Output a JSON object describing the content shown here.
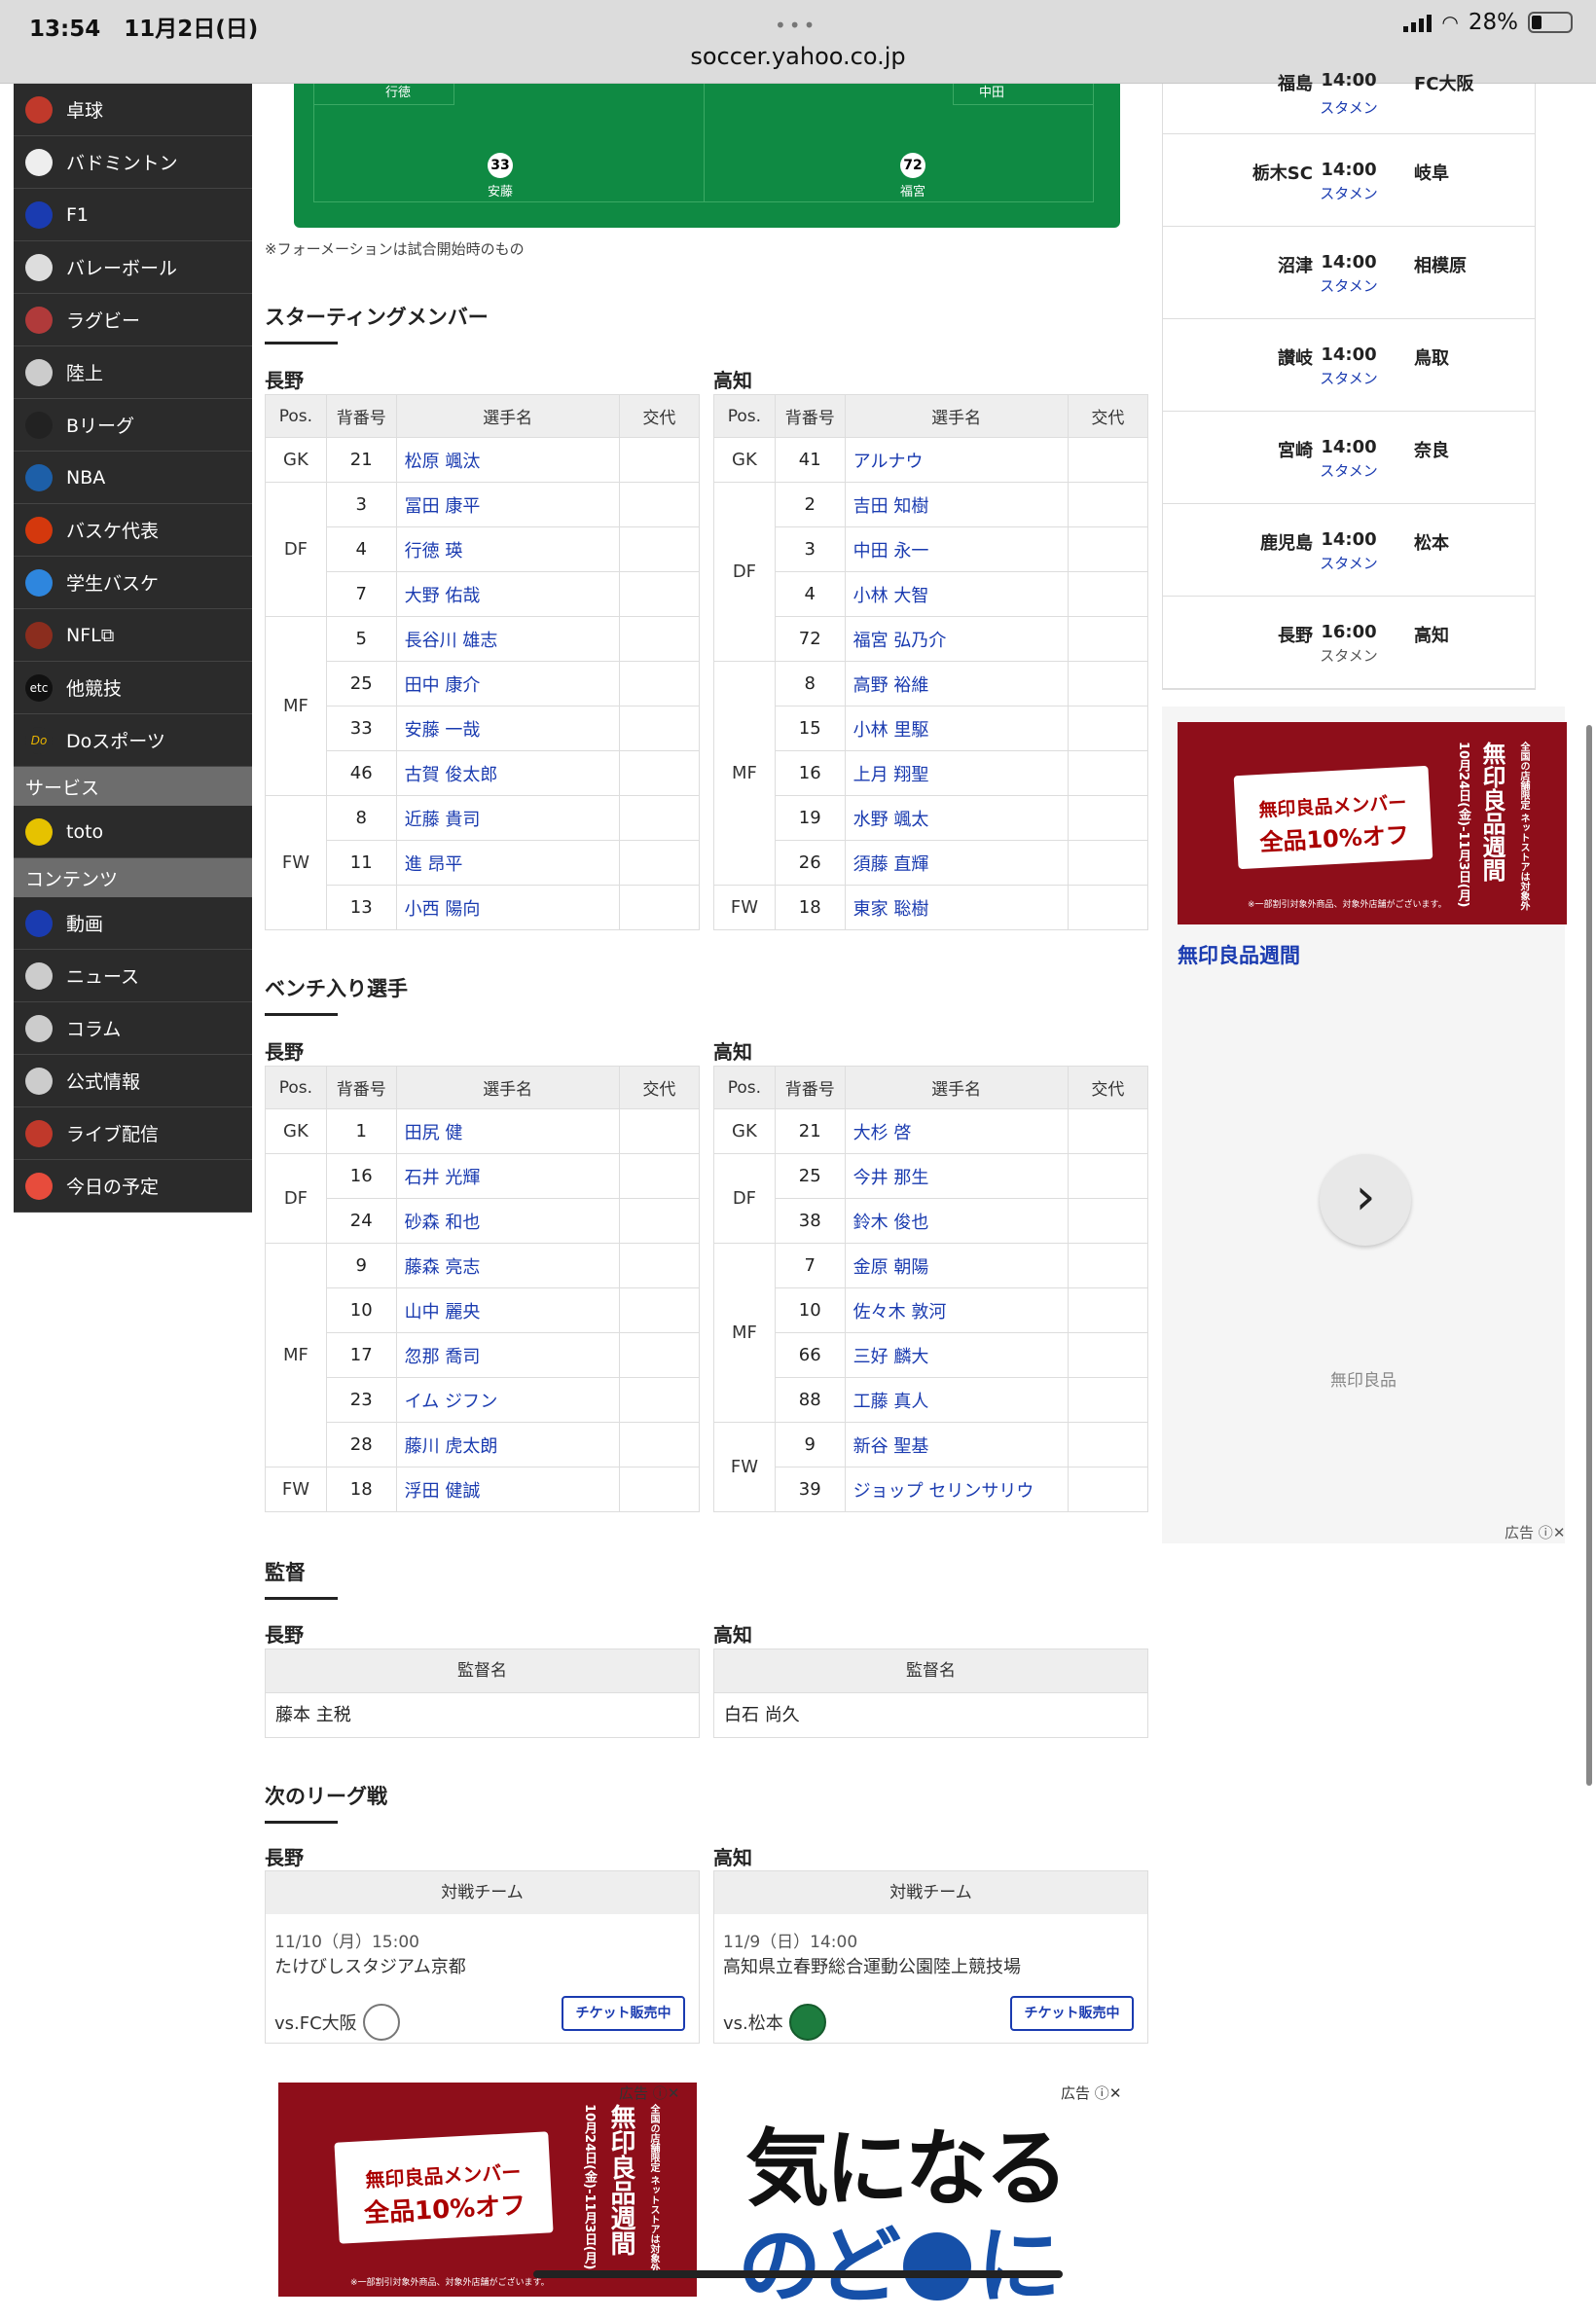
{
  "status_bar": {
    "time": "13:54",
    "date": "11月2日(日)",
    "url": "soccer.yahoo.co.jp",
    "battery": "28%"
  },
  "sidebar": {
    "items": [
      {
        "label": "卓球",
        "icon": "table-tennis-icon"
      },
      {
        "label": "バドミントン",
        "icon": "badminton-icon"
      },
      {
        "label": "F1",
        "icon": "f1-icon"
      },
      {
        "label": "バレーボール",
        "icon": "volleyball-icon"
      },
      {
        "label": "ラグビー",
        "icon": "rugby-icon"
      },
      {
        "label": "陸上",
        "icon": "athletics-icon"
      },
      {
        "label": "Bリーグ",
        "icon": "bleague-icon"
      },
      {
        "label": "NBA",
        "icon": "nba-icon"
      },
      {
        "label": "バスケ代表",
        "icon": "basketball-icon"
      },
      {
        "label": "学生バスケ",
        "icon": "college-basketball-icon"
      },
      {
        "label": "NFL",
        "icon": "nfl-icon"
      },
      {
        "label": "他競技",
        "icon": "etc-icon",
        "badge": "etc"
      },
      {
        "label": "Doスポーツ",
        "icon": "do-sports-icon",
        "badge": "Do"
      }
    ],
    "service_header": "サービス",
    "service_items": [
      {
        "label": "toto",
        "icon": "toto-icon"
      }
    ],
    "contents_header": "コンテンツ",
    "contents_items": [
      {
        "label": "動画",
        "icon": "video-icon"
      },
      {
        "label": "ニュース",
        "icon": "news-icon"
      },
      {
        "label": "コラム",
        "icon": "column-icon"
      },
      {
        "label": "公式情報",
        "icon": "official-info-icon"
      },
      {
        "label": "ライブ配信",
        "icon": "live-icon"
      },
      {
        "label": "今日の予定",
        "icon": "calendar-icon"
      }
    ]
  },
  "formation": {
    "players": [
      {
        "name": "行徳"
      },
      {
        "name": "中田"
      },
      {
        "num": "33",
        "name": "安藤"
      },
      {
        "num": "72",
        "name": "福宮"
      }
    ],
    "note": "※フォーメーションは試合開始時のもの"
  },
  "headers": {
    "pos": "Pos.",
    "num": "背番号",
    "name": "選手名",
    "sub": "交代"
  },
  "starting": {
    "title": "スターティングメンバー",
    "home": {
      "team": "長野",
      "rows": [
        {
          "pos": "GK",
          "num": "21",
          "name": "松原 颯汰"
        },
        {
          "pos": "DF",
          "num": "3",
          "name": "冨田 康平"
        },
        {
          "pos": "",
          "num": "4",
          "name": "行徳 瑛"
        },
        {
          "pos": "",
          "num": "7",
          "name": "大野 佑哉"
        },
        {
          "pos": "MF",
          "num": "5",
          "name": "長谷川 雄志"
        },
        {
          "pos": "",
          "num": "25",
          "name": "田中 康介"
        },
        {
          "pos": "",
          "num": "33",
          "name": "安藤 一哉"
        },
        {
          "pos": "",
          "num": "46",
          "name": "古賀 俊太郎"
        },
        {
          "pos": "FW",
          "num": "8",
          "name": "近藤 貴司"
        },
        {
          "pos": "",
          "num": "11",
          "name": "進 昂平"
        },
        {
          "pos": "",
          "num": "13",
          "name": "小西 陽向"
        }
      ]
    },
    "away": {
      "team": "高知",
      "rows": [
        {
          "pos": "GK",
          "num": "41",
          "name": "アルナウ"
        },
        {
          "pos": "DF",
          "num": "2",
          "name": "吉田 知樹"
        },
        {
          "pos": "",
          "num": "3",
          "name": "中田 永一"
        },
        {
          "pos": "",
          "num": "4",
          "name": "小林 大智"
        },
        {
          "pos": "",
          "num": "72",
          "name": "福宮 弘乃介"
        },
        {
          "pos": "MF",
          "num": "8",
          "name": "高野 裕維"
        },
        {
          "pos": "",
          "num": "15",
          "name": "小林 里駆"
        },
        {
          "pos": "",
          "num": "16",
          "name": "上月 翔聖"
        },
        {
          "pos": "",
          "num": "19",
          "name": "水野 颯太"
        },
        {
          "pos": "",
          "num": "26",
          "name": "須藤 直輝"
        },
        {
          "pos": "FW",
          "num": "18",
          "name": "東家 聡樹"
        }
      ]
    }
  },
  "bench": {
    "title": "ベンチ入り選手",
    "home": {
      "team": "長野",
      "rows": [
        {
          "pos": "GK",
          "num": "1",
          "name": "田尻 健"
        },
        {
          "pos": "DF",
          "num": "16",
          "name": "石井 光輝"
        },
        {
          "pos": "",
          "num": "24",
          "name": "砂森 和也"
        },
        {
          "pos": "MF",
          "num": "9",
          "name": "藤森 亮志"
        },
        {
          "pos": "",
          "num": "10",
          "name": "山中 麗央"
        },
        {
          "pos": "",
          "num": "17",
          "name": "忽那 喬司"
        },
        {
          "pos": "",
          "num": "23",
          "name": "イム ジフン"
        },
        {
          "pos": "",
          "num": "28",
          "name": "藤川 虎太朗"
        },
        {
          "pos": "FW",
          "num": "18",
          "name": "浮田 健誠"
        }
      ]
    },
    "away": {
      "team": "高知",
      "rows": [
        {
          "pos": "GK",
          "num": "21",
          "name": "大杉 啓"
        },
        {
          "pos": "DF",
          "num": "25",
          "name": "今井 那生"
        },
        {
          "pos": "",
          "num": "38",
          "name": "鈴木 俊也"
        },
        {
          "pos": "MF",
          "num": "7",
          "name": "金原 朝陽"
        },
        {
          "pos": "",
          "num": "10",
          "name": "佐々木 敦河"
        },
        {
          "pos": "",
          "num": "66",
          "name": "三好 麟大"
        },
        {
          "pos": "",
          "num": "88",
          "name": "工藤 真人"
        },
        {
          "pos": "FW",
          "num": "9",
          "name": "新谷 聖基"
        },
        {
          "pos": "",
          "num": "39",
          "name": "ジョップ セリンサリウ"
        }
      ]
    }
  },
  "coach": {
    "title": "監督",
    "header": "監督名",
    "home": {
      "team": "長野",
      "name": "藤本 主税"
    },
    "away": {
      "team": "高知",
      "name": "白石 尚久"
    }
  },
  "next_match": {
    "title": "次のリーグ戦",
    "header": "対戦チーム",
    "ticket_label": "チケット販売中",
    "home": {
      "team": "長野",
      "date": "11/10（月）15:00",
      "stadium": "たけびしスタジアム京都",
      "vs": "vs.FC大阪"
    },
    "away": {
      "team": "高知",
      "date": "11/9（日）14:00",
      "stadium": "高知県立春野総合運動公園陸上競技場",
      "vs": "vs.松本"
    }
  },
  "schedule": {
    "matches": [
      {
        "home": "福島",
        "time": "14:00",
        "away": "FC大阪",
        "status": "スタメン"
      },
      {
        "home": "栃木SC",
        "time": "14:00",
        "away": "岐阜",
        "status": "スタメン"
      },
      {
        "home": "沼津",
        "time": "14:00",
        "away": "相模原",
        "status": "スタメン"
      },
      {
        "home": "讃岐",
        "time": "14:00",
        "away": "鳥取",
        "status": "スタメン"
      },
      {
        "home": "宮崎",
        "time": "14:00",
        "away": "奈良",
        "status": "スタメン"
      },
      {
        "home": "鹿児島",
        "time": "14:00",
        "away": "松本",
        "status": "スタメン"
      },
      {
        "home": "長野",
        "time": "16:00",
        "away": "高知",
        "status": "スタメン"
      }
    ]
  },
  "ad": {
    "label": "広告",
    "title": "無印良品週間",
    "brand": "無印良品",
    "banner_line1": "無印良品メンバー",
    "banner_line2": "全品10%オフ",
    "banner_vertical": "無印良品週間",
    "banner_dates": "10月24日(金)-11月3日(月)",
    "banner_side": "全国の店舗限定 ネットストアは対象外",
    "banner_note": "※一部割引対象外商品、対象外店舗がございます。",
    "ad2_line1": "気になる",
    "ad2_line2": "のど",
    "ad2_line3": "に"
  }
}
